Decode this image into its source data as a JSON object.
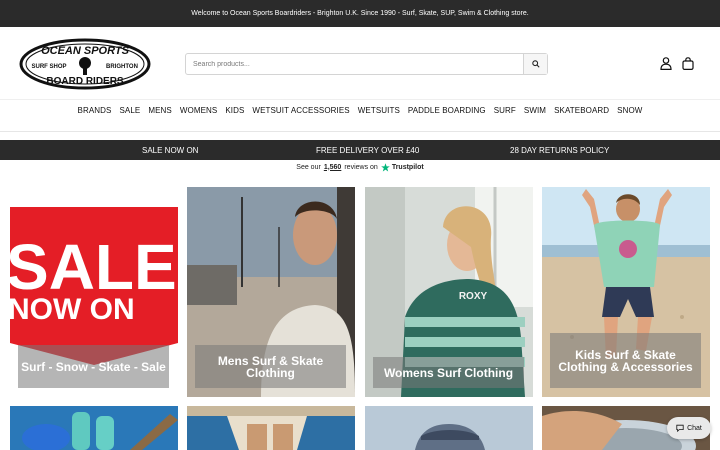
{
  "announcement": "Welcome to Ocean Sports Boardriders - Brighton U.K. Since 1990 - Surf, Skate, SUP, Swim & Clothing store.",
  "logo": {
    "top": "OCEAN SPORTS",
    "left": "SURF SHOP",
    "right": "BRIGHTON",
    "bottom": "BOARD RIDERS"
  },
  "search": {
    "placeholder": "Search products..."
  },
  "nav": [
    "BRANDS",
    "SALE",
    "MENS",
    "WOMENS",
    "KIDS",
    "WETSUIT ACCESSORIES",
    "WETSUITS",
    "PADDLE BOARDING",
    "SURF",
    "SWIM",
    "SKATEBOARD",
    "SNOW"
  ],
  "promo": {
    "left": "SALE NOW ON",
    "center": "FREE DELIVERY OVER £40",
    "right": "28 DAY RETURNS POLICY"
  },
  "trustpilot": {
    "prefix": "See our",
    "count": "1,560",
    "suffix": "reviews on",
    "brand": "Trustpilot"
  },
  "tiles": [
    {
      "label": "Surf - Snow - Skate - Sale",
      "banner": [
        "SALE",
        "NOW ON"
      ]
    },
    {
      "label": "Mens Surf & Skate Clothing"
    },
    {
      "label": "Womens Surf Clothing",
      "shirt_text": "ROXY"
    },
    {
      "label": "Kids Surf & Skate Clothing & Accessories"
    }
  ],
  "chat": {
    "label": "Chat"
  },
  "colors": {
    "dark_bar": "#2b2b2b",
    "sale_red": "#e41e26",
    "trustpilot_green": "#00b67a"
  },
  "icons": [
    "search-icon",
    "user-icon",
    "bag-icon",
    "trustpilot-star-icon",
    "chat-icon"
  ]
}
